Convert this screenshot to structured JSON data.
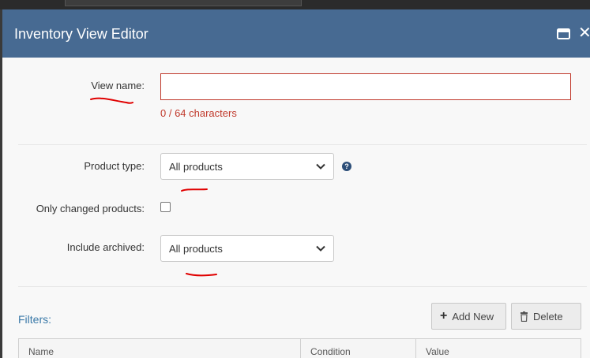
{
  "dialog": {
    "title": "Inventory View Editor",
    "maximize_icon": "maximize-icon",
    "close_icon": "close-icon"
  },
  "form": {
    "view_name": {
      "label": "View name:",
      "value": "",
      "placeholder": "",
      "char_count": "0 / 64 characters"
    },
    "product_type": {
      "label": "Product type:",
      "selected": "All products",
      "help_icon": "help-icon"
    },
    "only_changed": {
      "label": "Only changed products:",
      "checked": false
    },
    "include_archived": {
      "label": "Include archived:",
      "selected": "All products"
    }
  },
  "filters": {
    "label": "Filters:",
    "add_label": "Add New",
    "delete_label": "Delete",
    "columns": [
      "Name",
      "Condition",
      "Value"
    ]
  },
  "colors": {
    "titlebar": "#476a92",
    "error": "#c0392b",
    "link": "#3a79a8",
    "annotation": "#e00000"
  }
}
